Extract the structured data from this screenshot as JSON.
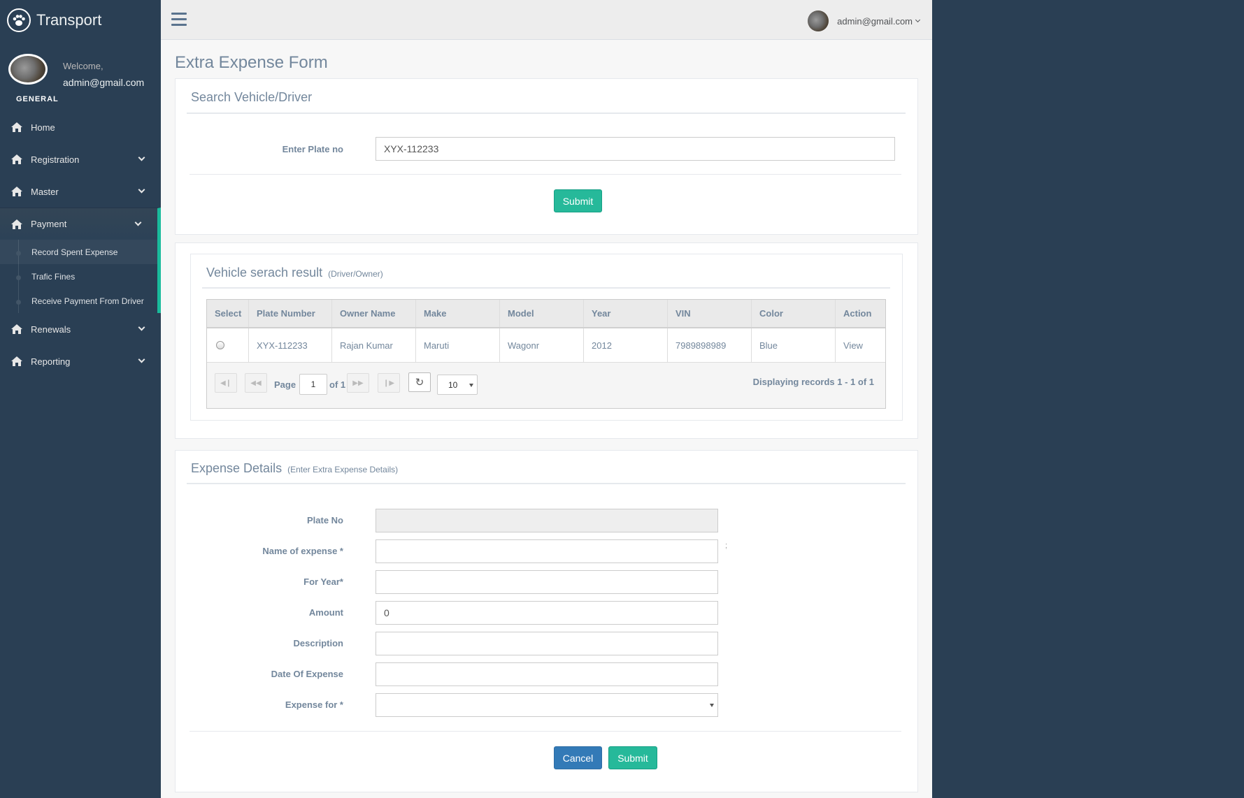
{
  "brand": {
    "title": "Transport",
    "logo_icon": "paw-icon"
  },
  "profile": {
    "welcome": "Welcome,",
    "email": "admin@gmail.com"
  },
  "sidebar": {
    "section": "GENERAL",
    "items": [
      {
        "label": "Home"
      },
      {
        "label": "Registration"
      },
      {
        "label": "Master"
      },
      {
        "label": "Payment"
      },
      {
        "label": "Renewals"
      },
      {
        "label": "Reporting"
      }
    ],
    "payment_sub": [
      {
        "label": "Record Spent Expense"
      },
      {
        "label": "Trafic Fines"
      },
      {
        "label": "Receive Payment From Driver"
      }
    ]
  },
  "topnav": {
    "user": "admin@gmail.com"
  },
  "page": {
    "title": "Extra Expense Form"
  },
  "search": {
    "title": "Search Vehicle/Driver",
    "plate_label": "Enter Plate no",
    "plate_value": "XYX-112233",
    "submit": "Submit"
  },
  "results": {
    "title": "Vehicle serach result",
    "subtitle": "(Driver/Owner)",
    "columns": [
      "Select",
      "Plate Number",
      "Owner Name",
      "Make",
      "Model",
      "Year",
      "VIN",
      "Color",
      "Action"
    ],
    "rows": [
      {
        "plate": "XYX-112233",
        "owner": "Rajan Kumar",
        "make": "Maruti",
        "model": "Wagonr",
        "year": "2012",
        "vin": "7989898989",
        "color": "Blue",
        "action": "View"
      }
    ],
    "pager": {
      "page_label": "Page",
      "page": "1",
      "of_label": "of 1",
      "page_size": "10",
      "records": "Displaying records 1 - 1 of 1"
    }
  },
  "expense": {
    "title": "Expense Details",
    "subtitle": "(Enter Extra Expense Details)",
    "fields": {
      "plate_label": "Plate No",
      "plate_value": "",
      "name_label": "Name of expense *",
      "name_value": "",
      "name_side_mark": ";",
      "year_label": "For Year*",
      "year_value": "",
      "amount_label": "Amount",
      "amount_value": "0",
      "desc_label": "Description",
      "desc_value": "",
      "date_label": "Date Of Expense",
      "date_value": "",
      "for_label": "Expense for *",
      "for_value": ""
    },
    "cancel": "Cancel",
    "submit": "Submit"
  },
  "colors": {
    "sidebar": "#2a3f54",
    "accent": "#1abb9c",
    "success": "#26b99a",
    "primary": "#337ab7",
    "text": "#73879c"
  }
}
